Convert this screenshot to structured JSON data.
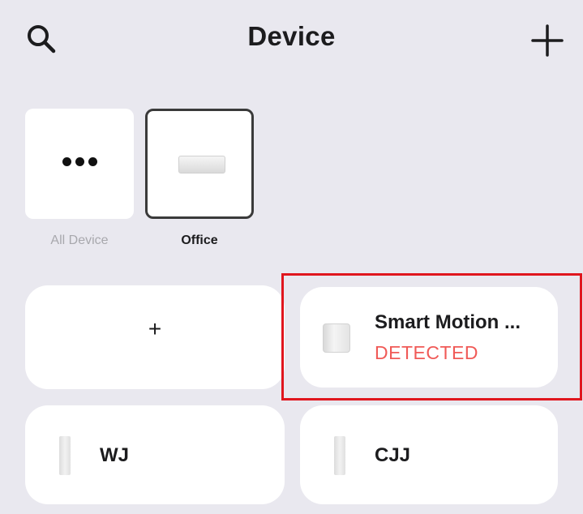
{
  "header": {
    "title": "Device",
    "search_icon": "search-icon",
    "add_icon": "plus-icon"
  },
  "rooms": [
    {
      "label": "All Device",
      "icon": "more-dots-icon",
      "selected": false
    },
    {
      "label": "Office",
      "icon": "office-device-image",
      "selected": true
    }
  ],
  "add_device_card": {
    "label": "+"
  },
  "devices": [
    {
      "name": "Smart Motion ...",
      "status": "DETECTED",
      "status_color": "#f05a57",
      "icon": "motion-sensor-icon"
    },
    {
      "name": "WJ",
      "icon": "switch-icon"
    },
    {
      "name": "CJJ",
      "icon": "switch-icon"
    }
  ],
  "colors": {
    "background": "#e9e8ef",
    "card": "#ffffff",
    "highlight": "#e0161e"
  }
}
